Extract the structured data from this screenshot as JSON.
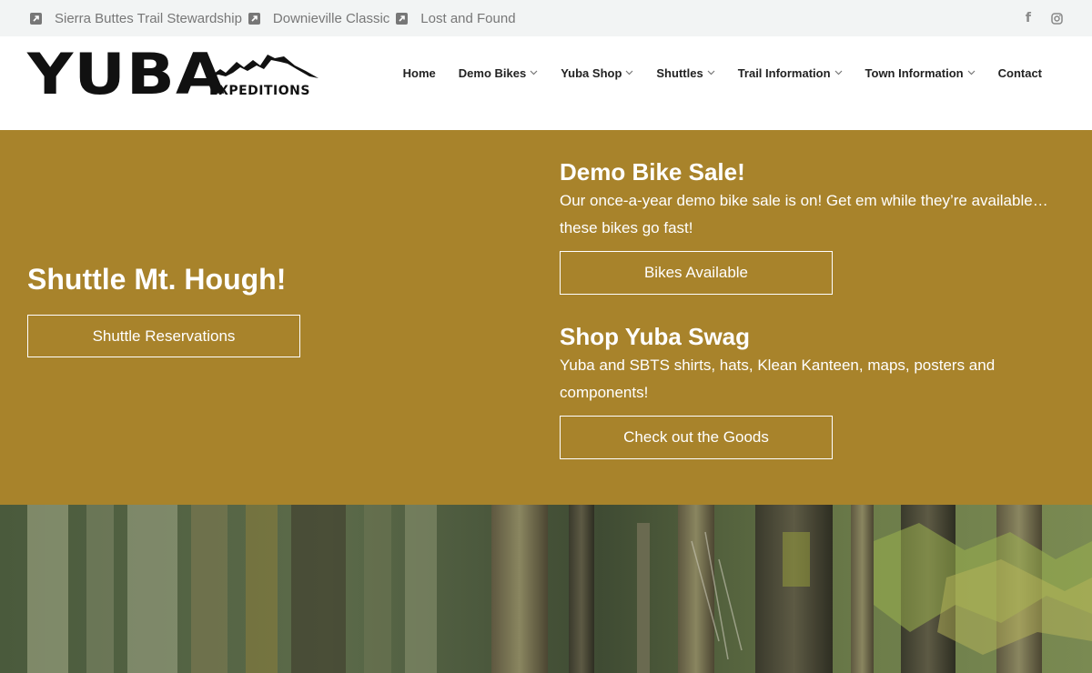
{
  "topbar": {
    "links": [
      {
        "label": "Sierra Buttes Trail Stewardship",
        "icon": "external-link-icon"
      },
      {
        "label": "Downieville Classic",
        "icon": "external-link-icon"
      },
      {
        "label": "Lost and Found",
        "icon": "external-link-icon"
      }
    ],
    "social": [
      {
        "label": "f",
        "icon": "facebook-icon"
      },
      {
        "icon": "instagram-icon"
      }
    ]
  },
  "logo": {
    "wordmark": "YUBA",
    "sub": "EXPEDITIONS"
  },
  "nav": {
    "items": [
      {
        "label": "Home",
        "has_dropdown": false
      },
      {
        "label": "Demo Bikes",
        "has_dropdown": true
      },
      {
        "label": "Yuba Shop",
        "has_dropdown": true
      },
      {
        "label": "Shuttles",
        "has_dropdown": true
      },
      {
        "label": "Trail Information",
        "has_dropdown": true
      },
      {
        "label": "Town Information",
        "has_dropdown": true
      },
      {
        "label": "Contact",
        "has_dropdown": false
      }
    ]
  },
  "hero": {
    "left_title": "Shuttle Mt. Hough!",
    "left_button": "Shuttle Reservations",
    "promo1_title": "Demo Bike Sale!",
    "promo1_text": "Our once-a-year demo bike sale is on! Get em while they’re available… these bikes go fast!",
    "promo1_button": "Bikes Available",
    "promo2_title": "Shop Yuba Swag",
    "promo2_text": "Yuba and SBTS shirts, hats, Klean Kanteen, maps, posters and components!",
    "promo2_button": "Check out the Goods"
  },
  "colors": {
    "band": "#a8832b",
    "topbar": "#f2f4f4"
  }
}
